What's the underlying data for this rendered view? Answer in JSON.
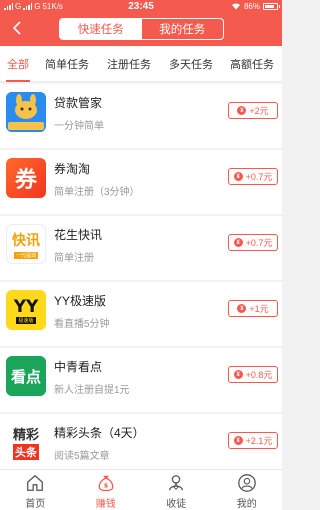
{
  "statusbar": {
    "carrier1": "G",
    "carrier2": "G",
    "speed": "51K/s",
    "time": "23:45",
    "battery": "86%"
  },
  "header": {
    "tabs": [
      {
        "label": "快速任务"
      },
      {
        "label": "我的任务"
      }
    ]
  },
  "categories": [
    {
      "label": "全部"
    },
    {
      "label": "简单任务"
    },
    {
      "label": "注册任务"
    },
    {
      "label": "多天任务"
    },
    {
      "label": "高额任务"
    }
  ],
  "tasks": [
    {
      "name": "贷款管家",
      "desc": "一分钟简单",
      "reward": "+2元",
      "logo_text": "贷款管家"
    },
    {
      "name": "券淘淘",
      "desc": "简单注册（3分钟）",
      "reward": "+0.7元",
      "logo_text": "券"
    },
    {
      "name": "花生快讯",
      "desc": "简单注册",
      "reward": "+0.7元",
      "logo_text": "快讯",
      "logo_sub": "一元提现"
    },
    {
      "name": "YY极速版",
      "desc": "看直播5分钟",
      "reward": "+1元",
      "logo_text": "YY",
      "logo_sub": "极速版"
    },
    {
      "name": "中青看点",
      "desc": "新人注册自提1元",
      "reward": "+0.8元",
      "logo_text": "看点"
    },
    {
      "name": "精彩头条（4天）",
      "desc": "阅读5篇文章",
      "reward": "+2.1元",
      "logo_text": "精彩",
      "logo_sub": "头条"
    }
  ],
  "tabbar": [
    {
      "label": "首页"
    },
    {
      "label": "赚钱"
    },
    {
      "label": "收徒"
    },
    {
      "label": "我的"
    }
  ],
  "colors": {
    "accent": "#f45a4e"
  }
}
